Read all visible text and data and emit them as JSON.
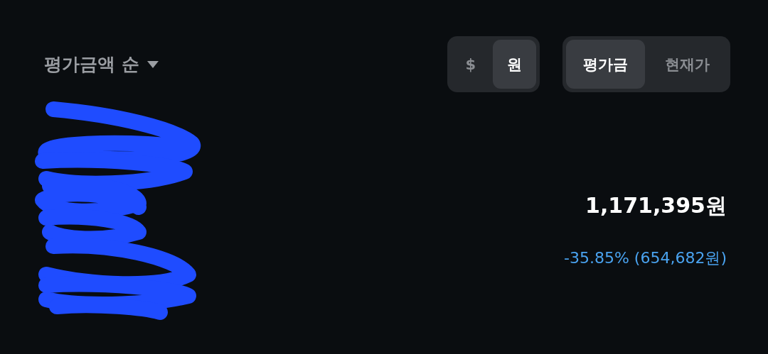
{
  "sort": {
    "label": "평가금액 순"
  },
  "currency_toggle": [
    {
      "label": "$",
      "selected": false
    },
    {
      "label": "원",
      "selected": true
    }
  ],
  "view_toggle": [
    {
      "label": "평가금",
      "selected": true
    },
    {
      "label": "현재가",
      "selected": false
    }
  ],
  "holding": {
    "value": "1,171,395원",
    "change": "-35.85% (654,682원)"
  }
}
